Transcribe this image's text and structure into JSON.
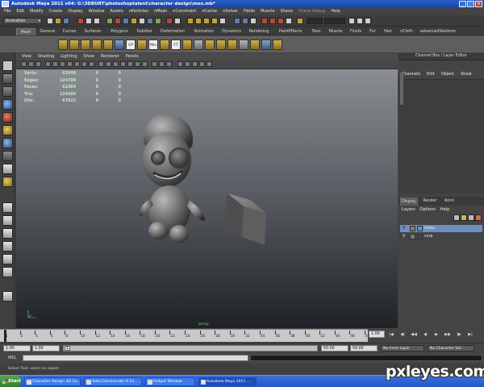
{
  "window": {
    "title": "Autodesk Maya 2011 x64: G:\\3DBURT\\photoshoptalent\\character design\\mox.mb*",
    "controls": [
      "_",
      "□",
      "×"
    ]
  },
  "menu_bar": [
    "File",
    "Edit",
    "Modify",
    "Create",
    "Display",
    "Window",
    "Assets",
    "nParticles",
    "nMesh",
    "nConstraint",
    "nCache",
    "nSolver",
    "Fields",
    "Muscle",
    "Shave",
    "Shave Debug",
    "Help"
  ],
  "status_line": {
    "mode": "Animation"
  },
  "shelf": {
    "tabs": [
      "Mesh",
      "General",
      "Curves",
      "Surfaces",
      "Polygons",
      "Subdivs",
      "Deformation",
      "Animation",
      "Dynamics",
      "Rendering",
      "PaintEffects",
      "Toon",
      "Muscle",
      "Fluids",
      "Fur",
      "Hair",
      "nCloth",
      "advancedSkeleton"
    ],
    "active_tab": "Mesh",
    "icon_labels": [
      "CP",
      "Mrs",
      "FT"
    ]
  },
  "viewport": {
    "menu": [
      "View",
      "Shading",
      "Lighting",
      "Show",
      "Renderer",
      "Panels"
    ],
    "camera_label": "persp",
    "hud": [
      {
        "label": "Verts:",
        "value": "62048",
        "sel": "0",
        "tri": "0"
      },
      {
        "label": "Edges:",
        "value": "124780",
        "sel": "0",
        "tri": "0"
      },
      {
        "label": "Faces:",
        "value": "62384",
        "sel": "0",
        "tri": "0"
      },
      {
        "label": "Tris:",
        "value": "124484",
        "sel": "0",
        "tri": "0"
      },
      {
        "label": "UVs:",
        "value": "67823",
        "sel": "0",
        "tri": "0"
      }
    ]
  },
  "channel_box": {
    "title": "Channel Box / Layer Editor",
    "menu": [
      "Channels",
      "Edit",
      "Object",
      "Show"
    ]
  },
  "layer_editor": {
    "tabs": [
      "Display",
      "Render",
      "Anim"
    ],
    "active_tab": "Display",
    "menu": [
      "Layers",
      "Options",
      "Help"
    ],
    "layers": [
      {
        "visible": "V",
        "name": "mosu",
        "selected": true
      },
      {
        "visible": "V",
        "name": "corp",
        "selected": false
      }
    ]
  },
  "time_slider": {
    "ticks": [
      "1",
      "2",
      "4",
      "6",
      "8",
      "10",
      "12",
      "14",
      "16",
      "18",
      "20",
      "22",
      "24",
      "26",
      "28",
      "30",
      "32",
      "34",
      "36",
      "38",
      "40",
      "42",
      "44",
      "46",
      "48"
    ],
    "current_frame": "1.00",
    "playback_buttons": [
      "|◀",
      "◀|",
      "◀◀",
      "◀",
      "▶",
      "▶▶",
      "|▶",
      "▶|"
    ]
  },
  "range_slider": {
    "start_field": "1.00",
    "inner_start": "1.00",
    "handle": "1",
    "inner_end": "50.00",
    "end_field": "50.00",
    "anim_layer": "No Anim Layer",
    "character_set": "No Character Set"
  },
  "command_line": {
    "label": "MEL",
    "help_text": "Select Tool: select an object"
  },
  "taskbar": {
    "start": "Start",
    "items": [
      {
        "label": "Character Design 3D Co...",
        "active": false
      },
      {
        "label": "Total Commander 6.53 - ...",
        "active": false
      },
      {
        "label": "Output Window",
        "active": false
      },
      {
        "label": "Autodesk Maya 2011 ...",
        "active": true
      }
    ]
  },
  "watermark": "pxleyes.com"
}
